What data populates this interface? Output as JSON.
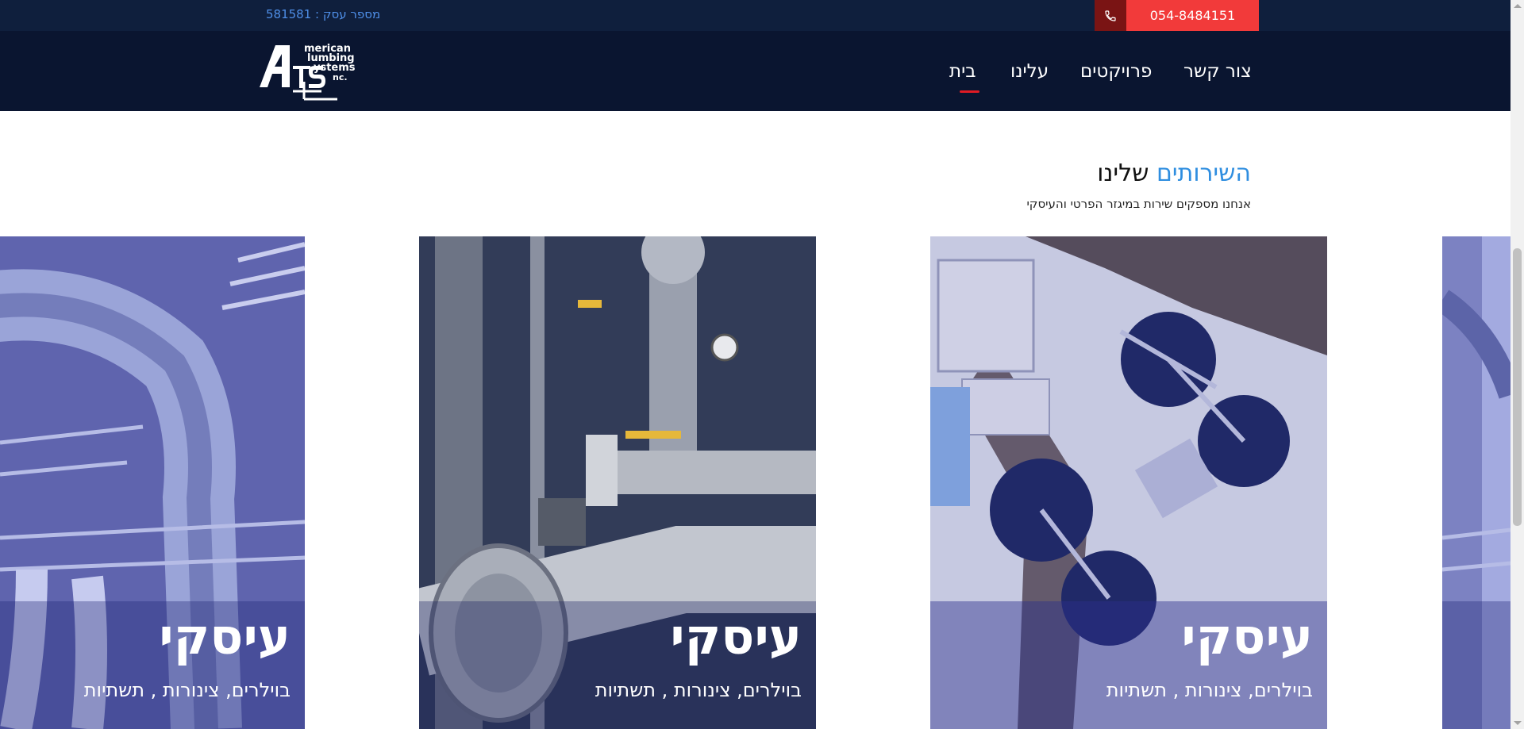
{
  "topbar": {
    "business_number": "מספר עסק : 581581",
    "phone": "054-8484151"
  },
  "nav": {
    "logo_text": {
      "line1": "merican",
      "line2": "lumbing",
      "line3": "ystems",
      "line4": "nc."
    },
    "items": [
      {
        "label": "צור קשר"
      },
      {
        "label": "פרויקטים"
      },
      {
        "label": "עלינו"
      },
      {
        "label": "בית"
      }
    ],
    "active_item": "בית"
  },
  "services": {
    "title_highlight": "השירותים",
    "title_rest": "שלינו",
    "subtitle": "אנחנו מספקים שירות במיגזר הפרטי והעיסקי"
  },
  "cards": [
    {
      "title": "עיסקי",
      "subtitle": "בוילרים, צינורות , תשתיות",
      "image": "ducts-photo"
    },
    {
      "title": "עיסקי",
      "subtitle": "בוילרים, צינורות , תשתיות",
      "image": "industrial-pipes-photo"
    },
    {
      "title": "עיסקי",
      "subtitle": "בוילרים, צינורות , תשתיות",
      "image": "water-treatment-aerial-photo"
    }
  ],
  "colors": {
    "topbar_bg": "#0f1f3d",
    "nav_bg": "#0a1530",
    "accent_red": "#f23a3a",
    "accent_blue": "#2f8ee0",
    "card_overlay": "#2a2f8a"
  }
}
